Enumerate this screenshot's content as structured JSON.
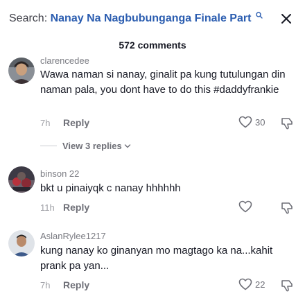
{
  "search": {
    "prefix": "Search:",
    "query": "Nanay Na Nagbubunganga Finale Part"
  },
  "comments_header": {
    "count_label": "572 comments"
  },
  "comments": [
    {
      "username": "clarencedee",
      "text": "Wawa naman si nanay, ginalit pa kung tutulungan din naman pala, you dont have to do this #daddyfrankie",
      "time": "7h",
      "reply_label": "Reply",
      "likes": "30",
      "view_replies": "View 3 replies"
    },
    {
      "username": "binson 22",
      "text": "bkt u pinaiyqk c nanay hhhhhh",
      "time": "11h",
      "reply_label": "Reply",
      "likes": ""
    },
    {
      "username": "AslanRylee1217",
      "text": "kung nanay ko ginanyan mo magtago ka na...kahit prank pa yan...",
      "time": "7h",
      "reply_label": "Reply",
      "likes": "22"
    }
  ],
  "icons": {
    "search": "search-icon",
    "close": "close-icon",
    "like": "heart-outline-icon",
    "dislike": "thumbs-down-icon",
    "expand": "chevron-down-icon"
  },
  "colors": {
    "query": "#2b5db0",
    "text": "#161823",
    "muted": "#a0a1a7"
  }
}
